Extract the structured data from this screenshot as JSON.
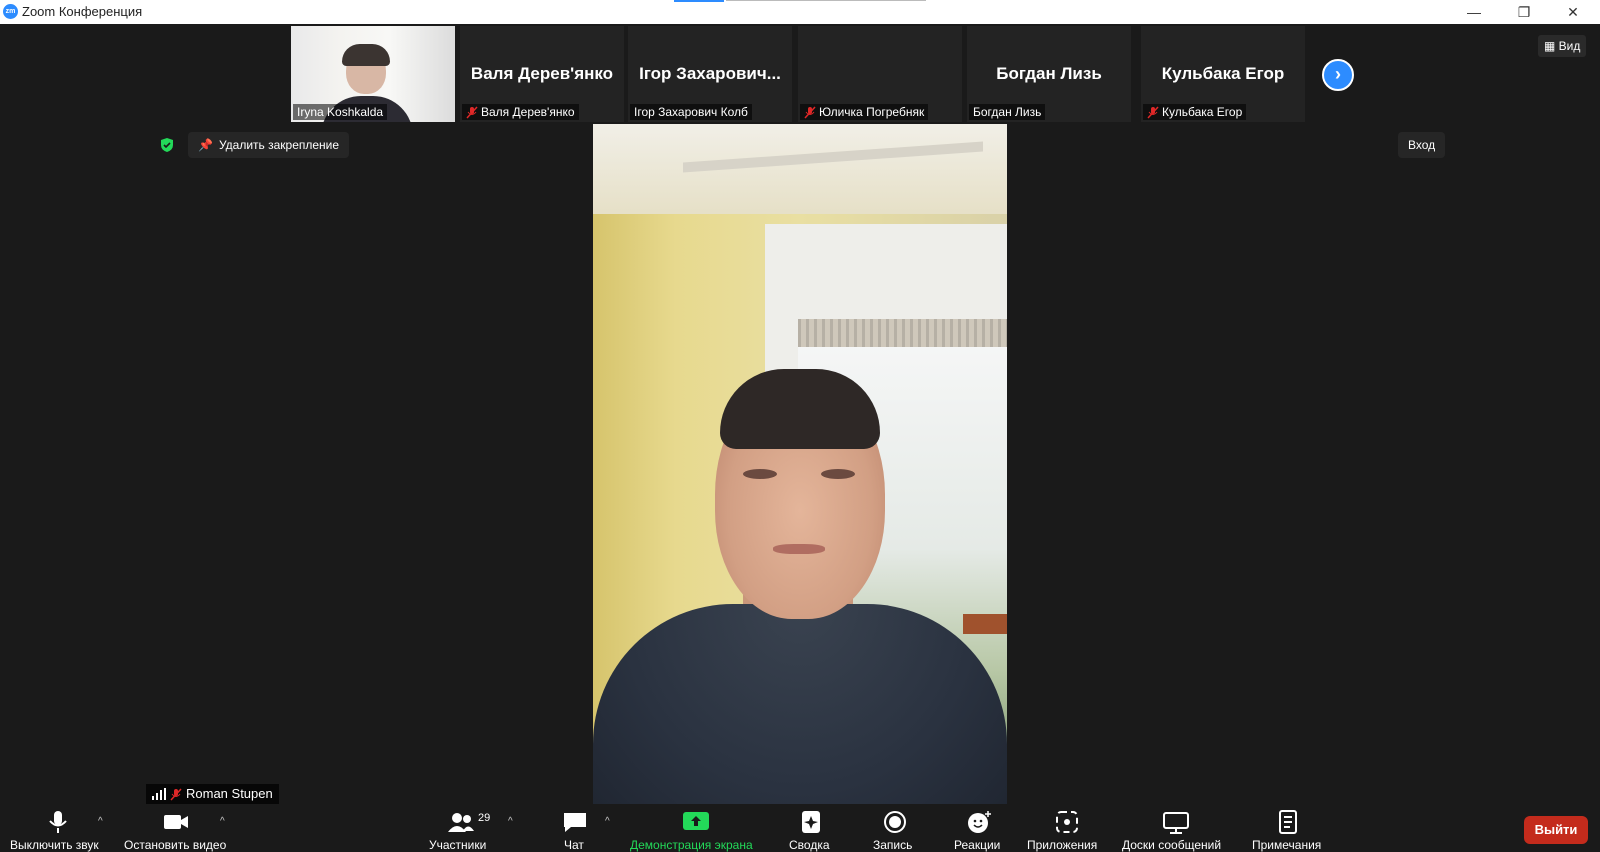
{
  "window": {
    "logo_text": "zm",
    "title": "Zoom Конференция",
    "minimize": "—",
    "restore": "❐",
    "close": "✕"
  },
  "filmstrip": {
    "tiles": [
      {
        "type": "video",
        "label": "Iryna Koshkalda",
        "muted": false
      },
      {
        "type": "name",
        "display": "Валя Дерев'янко",
        "label": "Валя Дерев'янко",
        "muted": true
      },
      {
        "type": "name",
        "display": "Ігор Захарович...",
        "label": "Ігор Захарович Колб",
        "muted": false
      },
      {
        "type": "name",
        "display": "",
        "label": "Юличка Погребняк",
        "muted": true
      },
      {
        "type": "name",
        "display": "Богдан Лизь",
        "label": "Богдан Лизь",
        "muted": false
      },
      {
        "type": "name",
        "display": "Кульбака Егор",
        "label": "Кульбака Егор",
        "muted": true
      }
    ],
    "next_icon": "›",
    "view_label": "Вид"
  },
  "top_controls": {
    "unpin_label": "Удалить закрепление",
    "enter_label": "Вход"
  },
  "main_speaker": {
    "name": "Roman Stupen",
    "muted": true
  },
  "toolbar": {
    "mute_label": "Выключить звук",
    "video_label": "Остановить видео",
    "participants_label": "Участники",
    "participants_count": "29",
    "chat_label": "Чат",
    "share_label": "Демонстрация экрана",
    "summary_label": "Сводка",
    "record_label": "Запись",
    "reactions_label": "Реакции",
    "apps_label": "Приложения",
    "whiteboards_label": "Доски сообщений",
    "notes_label": "Примечания",
    "leave_label": "Выйти",
    "caret": "^"
  },
  "colors": {
    "accent": "#2d8cff",
    "share_green": "#23d959",
    "leave_red": "#c42b1c",
    "mute_red": "#e02828",
    "shield_green": "#23d959"
  }
}
